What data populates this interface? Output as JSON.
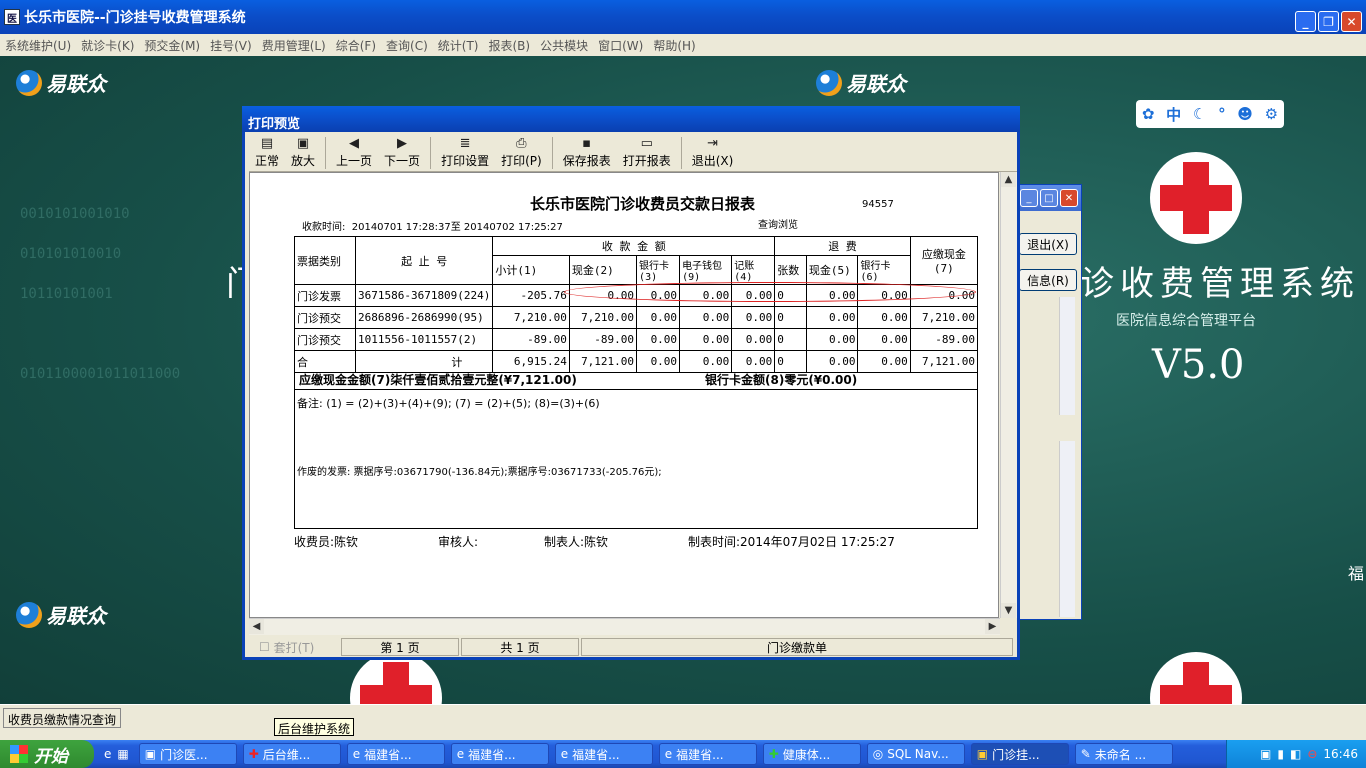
{
  "app": {
    "title": "长乐市医院--门诊挂号收费管理系统",
    "icon_text": "医"
  },
  "menu": [
    "系统维护(U)",
    "就诊卡(K)",
    "预交金(M)",
    "挂号(V)",
    "费用管理(L)",
    "综合(F)",
    "查询(C)",
    "统计(T)",
    "报表(B)",
    "公共模块",
    "窗口(W)",
    "帮助(H)"
  ],
  "desktop": {
    "logo_text": "易联众",
    "big_title": "诊收费管理系统",
    "left_partial": "门",
    "subtitle": "医院信息综合管理平台",
    "version": "V5.0",
    "right_partial": "福",
    "deco_binary": [
      "0010101001010",
      "010101010010",
      "10110101001",
      "0101100001011011000"
    ],
    "toolicons": [
      "paw-icon",
      "中",
      "moon-icon",
      "dots-icon",
      "user-icon",
      "gear-icon"
    ]
  },
  "bgwin": {
    "exit_label": "退出(X)",
    "info_label": "信息(R)"
  },
  "dialog": {
    "title": "打印预览",
    "toolbar": [
      {
        "label": "正常",
        "icon": "▤"
      },
      {
        "label": "放大",
        "icon": "▣"
      },
      {
        "label": "上一页",
        "icon": "◀"
      },
      {
        "label": "下一页",
        "icon": "▶"
      },
      {
        "label": "打印设置",
        "icon": "≣"
      },
      {
        "label": "打印(P)",
        "icon": "⎙"
      },
      {
        "label": "保存报表",
        "icon": "▪"
      },
      {
        "label": "打开报表",
        "icon": "▭"
      },
      {
        "label": "退出(X)",
        "icon": "⇥"
      }
    ],
    "status": {
      "checkbox": "套打(T)",
      "page_num": "第 1 页",
      "page_total": "共 1 页",
      "doc_name": "门诊缴款单"
    }
  },
  "report": {
    "title": "长乐市医院门诊收费员交款日报表",
    "code": "94557",
    "time_label": "收款时间:",
    "time_range": "20140701 17:28:37至 20140702 17:25:27",
    "query_label": "查询浏览",
    "headers": {
      "type": "票据类别",
      "range": "起  止  号",
      "collect": "收  款  金  额",
      "refund": "退  费",
      "due": "应缴现金(7)",
      "subtotal": "小计(1)",
      "cash": "现金(2)",
      "bank": "银行卡(3)",
      "ewallet": "电子钱包(9)",
      "credit": "记账(4)",
      "count": "张数",
      "rcash": "现金(5)",
      "rbank": "银行卡(6)"
    },
    "rows": [
      {
        "type": "门诊发票",
        "range": "3671586-3671809(224)",
        "subtotal": "-205.76",
        "cash": "0.00",
        "bank": "0.00",
        "ewallet": "0.00",
        "credit": "0.00",
        "count": "0",
        "rcash": "0.00",
        "rbank": "0.00",
        "due": "0.00"
      },
      {
        "type": "门诊预交",
        "range": "2686896-2686990(95)",
        "subtotal": "7,210.00",
        "cash": "7,210.00",
        "bank": "0.00",
        "ewallet": "0.00",
        "credit": "0.00",
        "count": "0",
        "rcash": "0.00",
        "rbank": "0.00",
        "due": "7,210.00"
      },
      {
        "type": "门诊预交",
        "range": "1011556-1011557(2)",
        "subtotal": "-89.00",
        "cash": "-89.00",
        "bank": "0.00",
        "ewallet": "0.00",
        "credit": "0.00",
        "count": "0",
        "rcash": "0.00",
        "rbank": "0.00",
        "due": "-89.00"
      },
      {
        "type": "合",
        "range": "计",
        "subtotal": "6,915.24",
        "cash": "7,121.00",
        "bank": "0.00",
        "ewallet": "0.00",
        "credit": "0.00",
        "count": "0",
        "rcash": "0.00",
        "rbank": "0.00",
        "due": "7,121.00"
      }
    ],
    "sum_line": "应缴现金金额(7)柒仟壹佰贰拾壹元整(¥7,121.00)",
    "bank_line": "银行卡金额(8)零元(¥0.00)",
    "note": "备注:  (1) = (2)+(3)+(4)+(9);  (7) = (2)+(5);  (8)=(3)+(6)",
    "void": "作废的发票:   票据序号:03671790(-136.84元);票据序号:03671733(-205.76元);",
    "footer": {
      "cashier": "收费员:陈钦",
      "auditor": "审核人:",
      "maker": "制表人:陈钦",
      "made_time": "制表时间:2014年07月02日  17:25:27"
    }
  },
  "bottom": {
    "query_tab": "收费员缴款情况查询",
    "tooltip": "后台维护系统"
  },
  "taskbar": {
    "start": "开始",
    "items": [
      {
        "label": "门诊医...",
        "icon": "▣"
      },
      {
        "label": "后台维...",
        "icon": "✚"
      },
      {
        "label": "福建省...",
        "icon": "e"
      },
      {
        "label": "福建省...",
        "icon": "e"
      },
      {
        "label": "福建省...",
        "icon": "e"
      },
      {
        "label": "福建省...",
        "icon": "e"
      },
      {
        "label": "健康体...",
        "icon": "✚"
      },
      {
        "label": "SQL Nav...",
        "icon": "◎"
      },
      {
        "label": "门诊挂...",
        "icon": "▣"
      },
      {
        "label": "未命名 ...",
        "icon": "✎"
      }
    ],
    "clock": "16:46"
  }
}
